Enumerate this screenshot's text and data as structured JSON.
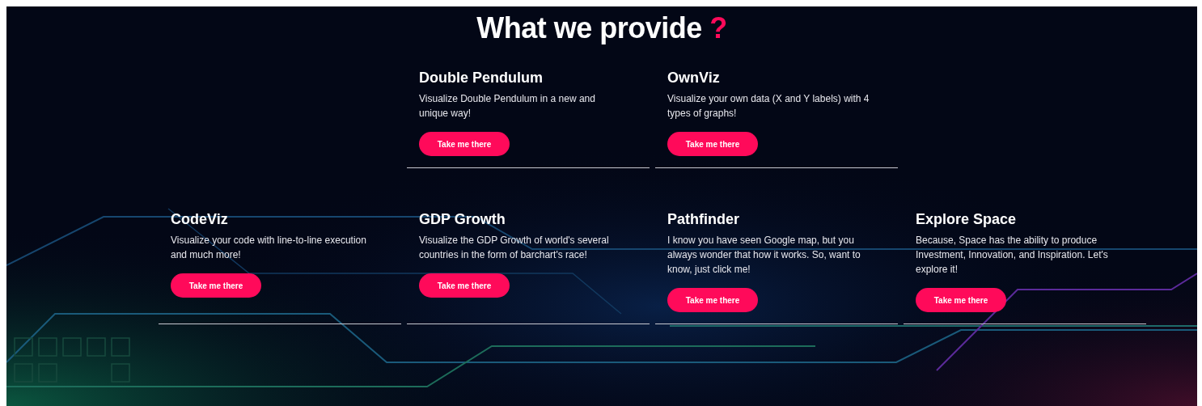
{
  "heading": {
    "text": "What we provide",
    "mark": "?"
  },
  "rows": [
    {
      "cards": [
        {
          "title": "Double Pendulum",
          "description": "Visualize Double Pendulum in a new and unique way!",
          "button": "Take me there"
        },
        {
          "title": "OwnViz",
          "description": "Visualize your own data (X and Y labels) with 4 types of graphs!",
          "button": "Take me there"
        }
      ]
    },
    {
      "cards": [
        {
          "title": "CodeViz",
          "description": "Visualize your code with line-to-line execution and much more!",
          "button": "Take me there"
        },
        {
          "title": "GDP Growth",
          "description": "Visualize the GDP Growth of world's several countries in the form of barchart's race!",
          "button": "Take me there"
        },
        {
          "title": "Pathfinder",
          "description": "I know you have seen Google map, but you always wonder that how it works. So, want to know, just click me!",
          "button": "Take me there"
        },
        {
          "title": "Explore Space",
          "description": "Because, Space has the ability to produce Investment, Innovation, and Inspiration. Let's explore it!",
          "button": "Take me there"
        }
      ]
    }
  ]
}
